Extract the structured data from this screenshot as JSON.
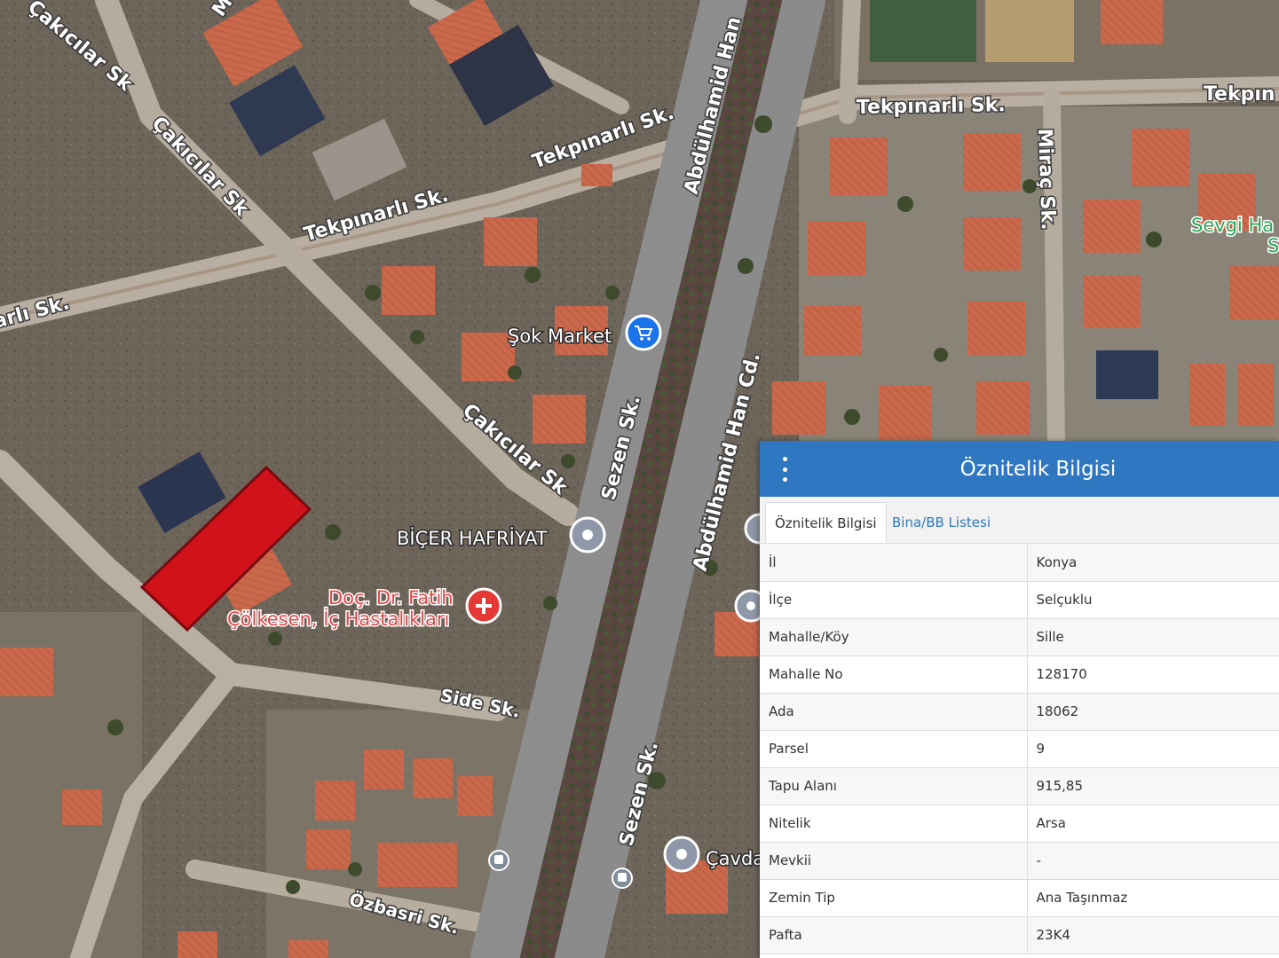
{
  "map": {
    "roads": [
      {
        "id": "cakicilar-1",
        "label": "Çakıcılar Sk"
      },
      {
        "id": "cakicilar-2",
        "label": "Çakıcılar Sk"
      },
      {
        "id": "cakicilar-3",
        "label": "Çakıcılar Sk"
      },
      {
        "id": "tekpinarli-1",
        "label": "Tekpınarlı Sk."
      },
      {
        "id": "tekpinarli-2",
        "label": "Tekpınarlı Sk."
      },
      {
        "id": "tekpinarli-3",
        "label": "Tekpınarlı Sk."
      },
      {
        "id": "tekpinarli-4",
        "label": "Tekpın"
      },
      {
        "id": "arli",
        "label": "arlı Sk."
      },
      {
        "id": "abdulhamid-1",
        "label": "Abdülhamid Han"
      },
      {
        "id": "abdulhamid-2",
        "label": "Abdülhamid Han Cd."
      },
      {
        "id": "sezen-1",
        "label": "Sezen Sk."
      },
      {
        "id": "sezen-2",
        "label": "Sezen Sk."
      },
      {
        "id": "mirac",
        "label": "Miraç Sk."
      },
      {
        "id": "side",
        "label": "Side Sk."
      },
      {
        "id": "ozbasri",
        "label": "Özbasri Sk."
      },
      {
        "id": "m",
        "label": "M"
      }
    ],
    "pois": {
      "sok_market": "Şok Market",
      "bicer": "BİÇER HAFRİYAT",
      "doctor_line1": "Doç. Dr. Fatih",
      "doctor_line2": "Çölkesen, İç Hastalıkları",
      "sevgi_line1": "Sevgi Ha",
      "sevgi_line2": "S",
      "cavda": "Çavda"
    },
    "colors": {
      "parcel": "#d0121b",
      "parcel_border": "#7a0a10",
      "poi_pin": "#1a73e8",
      "health_pin": "#e53935",
      "panel_header": "#2f77c0"
    }
  },
  "panel": {
    "title": "Öznitelik Bilgisi",
    "tabs": {
      "active": "Öznitelik Bilgisi",
      "other": "Bina/BB Listesi"
    },
    "rows": [
      {
        "key": "İl",
        "value": "Konya"
      },
      {
        "key": "İlçe",
        "value": "Selçuklu"
      },
      {
        "key": "Mahalle/Köy",
        "value": "Sille"
      },
      {
        "key": "Mahalle No",
        "value": "128170"
      },
      {
        "key": "Ada",
        "value": "18062"
      },
      {
        "key": "Parsel",
        "value": "9"
      },
      {
        "key": "Tapu Alanı",
        "value": "915,85"
      },
      {
        "key": "Nitelik",
        "value": "Arsa"
      },
      {
        "key": "Mevkii",
        "value": "-"
      },
      {
        "key": "Zemin Tip",
        "value": "Ana Taşınmaz"
      },
      {
        "key": "Pafta",
        "value": "23K4"
      }
    ]
  }
}
